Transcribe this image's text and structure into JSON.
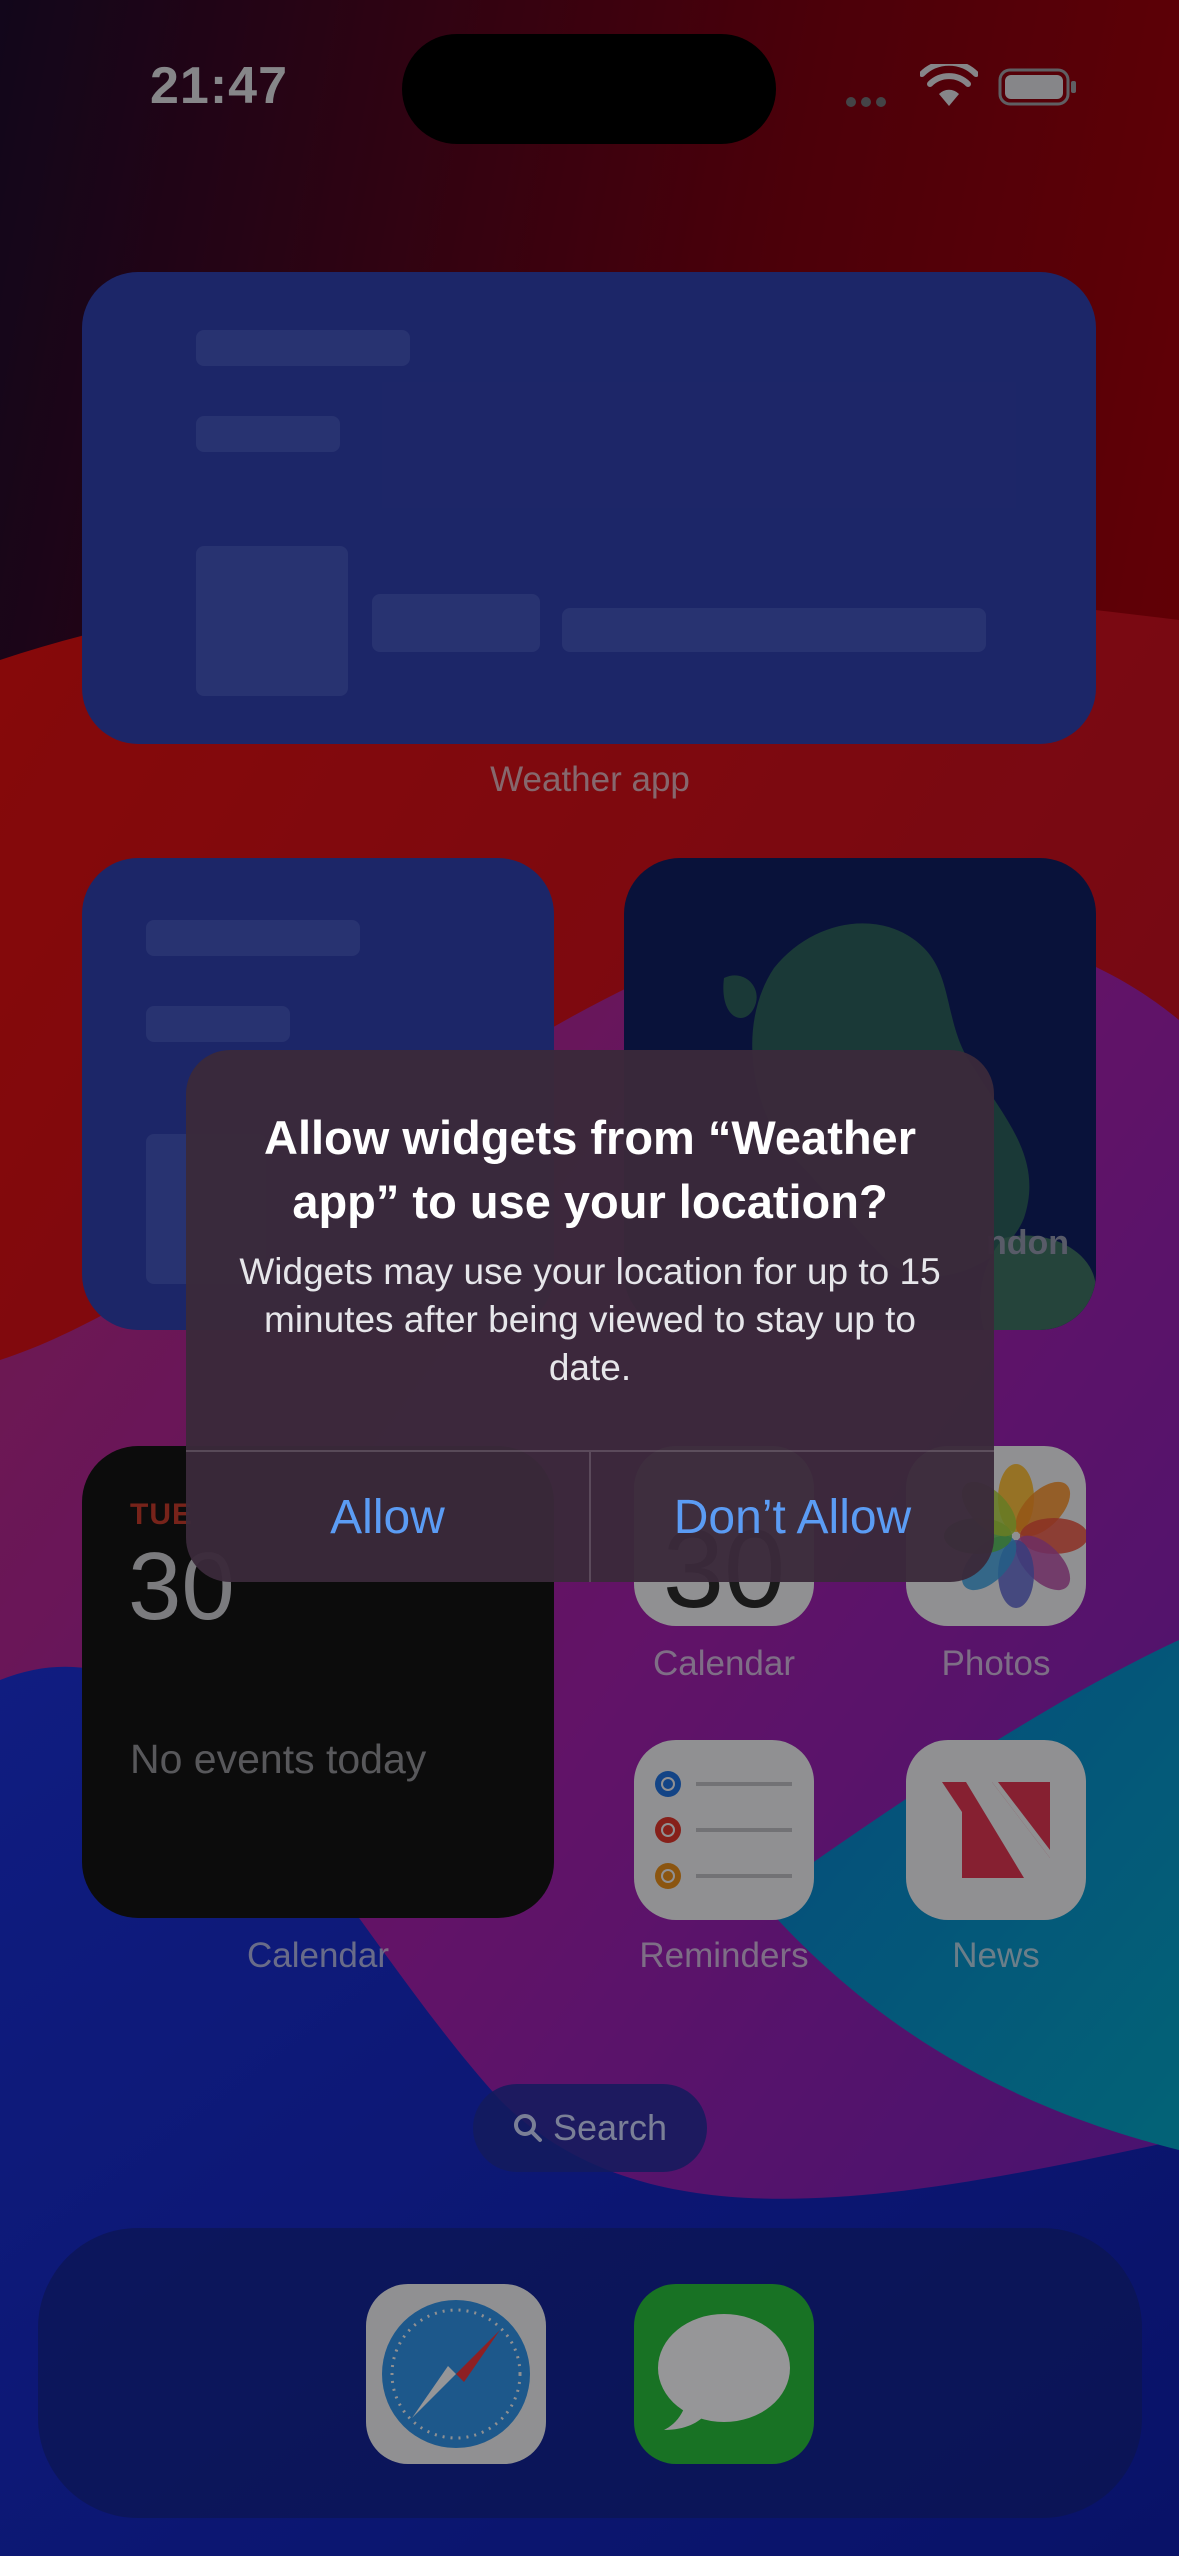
{
  "status_bar": {
    "time": "21:47"
  },
  "widgets": {
    "weather_large": {
      "caption": "Weather app"
    },
    "map_widget": {
      "partial_label": "ndon"
    },
    "calendar_widget": {
      "day": "TUE",
      "date": "30",
      "no_events": "No events today",
      "caption": "Calendar"
    }
  },
  "apps": [
    {
      "name": "Calendar",
      "icon": "calendar-icon"
    },
    {
      "name": "Photos",
      "icon": "photos-icon"
    },
    {
      "name": "Reminders",
      "icon": "reminders-icon"
    },
    {
      "name": "News",
      "icon": "news-icon"
    }
  ],
  "search": {
    "label": "Search",
    "icon": "search-icon"
  },
  "dock": {
    "apps": [
      {
        "icon": "safari-icon"
      },
      {
        "icon": "messages-icon"
      }
    ]
  },
  "alert": {
    "title": "Allow widgets from “Weather app” to use your location?",
    "message": "Widgets may use your location for up to 15 minutes after being viewed to stay up to date.",
    "allow_label": "Allow",
    "dont_allow_label": "Don’t Allow",
    "button_color": "#5b9cf4"
  }
}
